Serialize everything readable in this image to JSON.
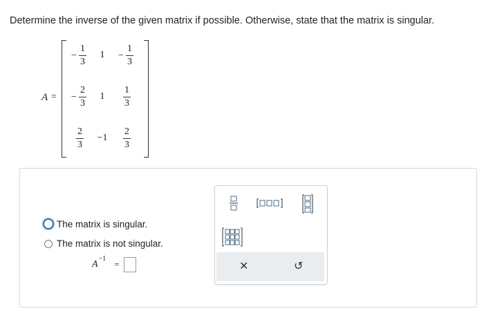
{
  "question": {
    "prompt": "Determine the inverse of the given matrix if possible. Otherwise, state that the matrix is singular."
  },
  "matrix": {
    "label": "A",
    "equals": "=",
    "rows": [
      [
        {
          "sign": "−",
          "num": "1",
          "den": "3"
        },
        {
          "value": "1"
        },
        {
          "sign": "−",
          "num": "1",
          "den": "3"
        }
      ],
      [
        {
          "sign": "−",
          "num": "2",
          "den": "3"
        },
        {
          "value": "1"
        },
        {
          "sign": "",
          "num": "1",
          "den": "3"
        }
      ],
      [
        {
          "sign": "",
          "num": "2",
          "den": "3"
        },
        {
          "value": "−1"
        },
        {
          "sign": "",
          "num": "2",
          "den": "3"
        }
      ]
    ]
  },
  "answer": {
    "options": [
      {
        "label": "The matrix is singular.",
        "selected": true
      },
      {
        "label": "The matrix is not singular.",
        "selected": false
      }
    ],
    "inverse_base": "A",
    "inverse_exponent": "−1",
    "inverse_equals": "=",
    "input_value": ""
  },
  "palette": {
    "buttons": [
      "fraction-template-icon",
      "row-vector-template-icon",
      "column-vector-template-icon",
      "matrix-template-icon"
    ],
    "clear_label": "✕",
    "undo_label": "↺"
  },
  "colors": {
    "accent": "#1f6fb2",
    "palette_footer": "#e9edf0",
    "panel_border": "#d6d6d6"
  }
}
